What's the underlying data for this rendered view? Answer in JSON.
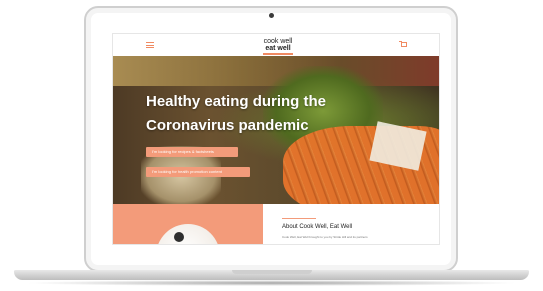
{
  "site": {
    "logo_line1": "cook well",
    "logo_line2": "eat well"
  },
  "hero": {
    "title": "Healthy eating during the Coronavirus pandemic",
    "buttons": [
      {
        "label": "I'm looking for recipes & factsheets"
      },
      {
        "label": "I'm looking for health promotion content"
      }
    ]
  },
  "about": {
    "heading": "About Cook Well, Eat Well",
    "text": "Cook Well, Eat Well brought to you by Stride Hill and its partners"
  },
  "icons": {
    "menu": "menu-icon",
    "cart": "cart-icon"
  },
  "colors": {
    "accent": "#f39b7a",
    "brand_text": "#222222"
  }
}
